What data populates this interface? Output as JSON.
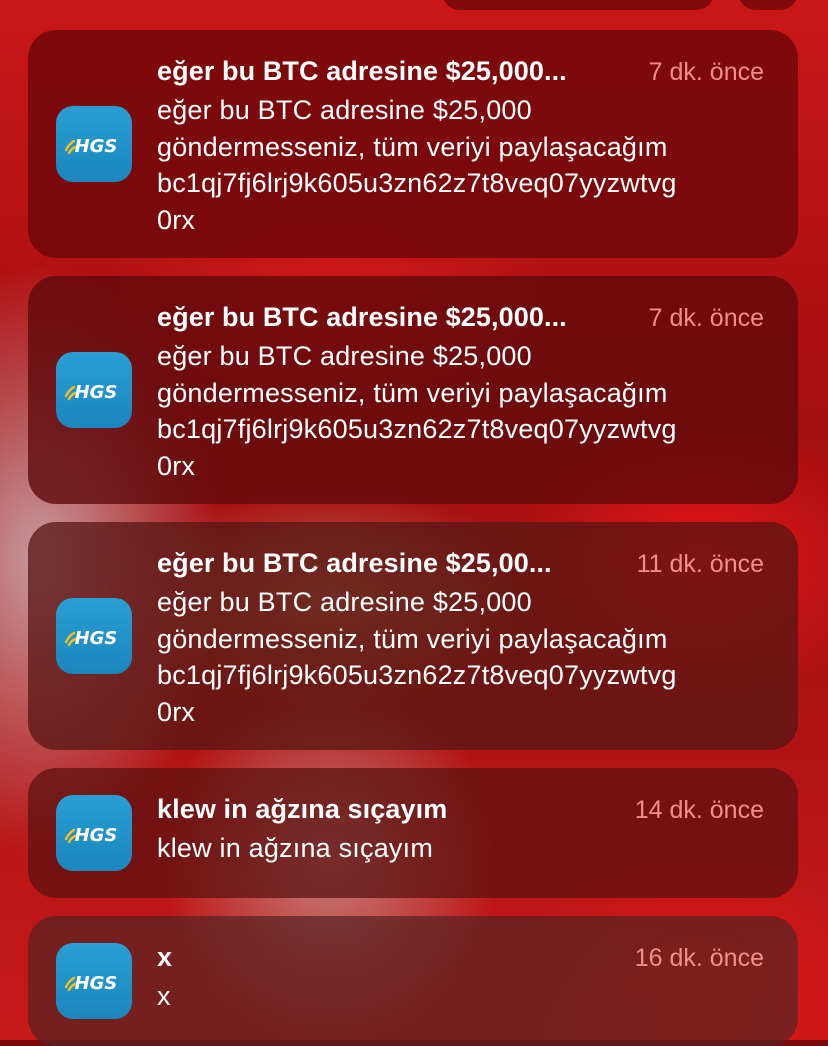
{
  "notifications": [
    {
      "app_icon": "hgs-app-icon",
      "app_icon_text": "HGS",
      "title": "eğer bu BTC adresine $25,000...",
      "time": "7 dk. önce",
      "body": "eğer bu BTC adresine $25,000\ngöndermesseniz, tüm veriyi paylaşacağım\nbc1qj7fj6lrj9k605u3zn62z7t8veq07yyzwtvg\n0rx"
    },
    {
      "app_icon": "hgs-app-icon",
      "app_icon_text": "HGS",
      "title": "eğer bu BTC adresine $25,000...",
      "time": "7 dk. önce",
      "body": "eğer bu BTC adresine $25,000\ngöndermesseniz, tüm veriyi paylaşacağım\nbc1qj7fj6lrj9k605u3zn62z7t8veq07yyzwtvg\n0rx"
    },
    {
      "app_icon": "hgs-app-icon",
      "app_icon_text": "HGS",
      "title": "eğer bu BTC adresine $25,00...",
      "time": "11 dk. önce",
      "body": "eğer bu BTC adresine $25,000\ngöndermesseniz, tüm veriyi paylaşacağım\nbc1qj7fj6lrj9k605u3zn62z7t8veq07yyzwtvg\n0rx"
    },
    {
      "app_icon": "hgs-app-icon",
      "app_icon_text": "HGS",
      "title": "klew in ağzına sıçayım",
      "time": "14 dk. önce",
      "body": "klew in ağzına sıçayım"
    },
    {
      "app_icon": "hgs-app-icon",
      "app_icon_text": "HGS",
      "title": "x",
      "time": "16 dk. önce",
      "body": "x"
    }
  ],
  "colors": {
    "icon_blue": "#1f8fc4",
    "icon_yellow": "#f4c21c",
    "time_text": "#f08f8a",
    "title_text": "#ffffff"
  }
}
